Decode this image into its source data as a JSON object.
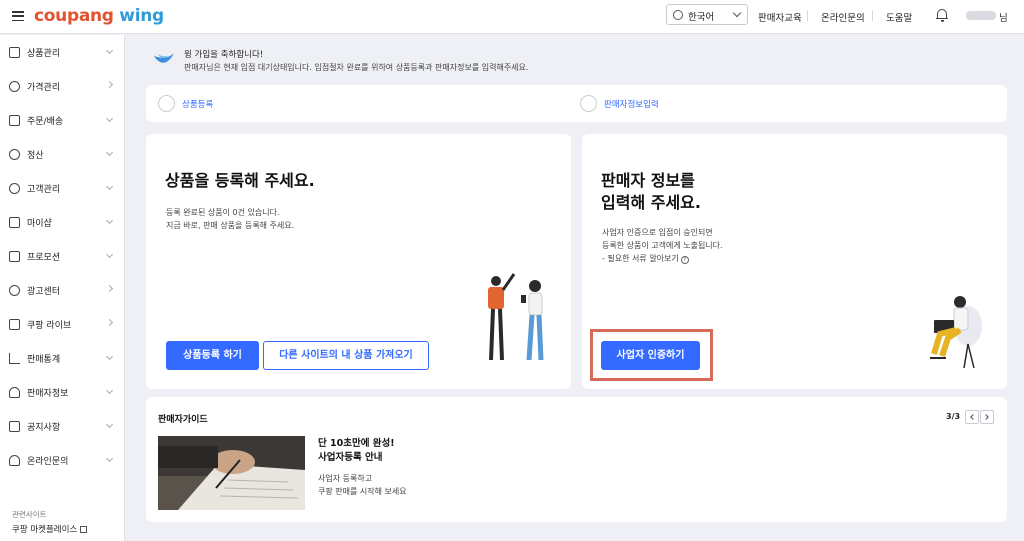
{
  "header": {
    "logo_part1": "coupang",
    "logo_part2": " wing",
    "language": "한국어",
    "links": [
      "판매자교육",
      "온라인문의",
      "도움말"
    ],
    "user_suffix": "님"
  },
  "sidebar": {
    "items": [
      {
        "label": "상품관리",
        "icon": "box-icon",
        "arrow": "down"
      },
      {
        "label": "가격관리",
        "icon": "medal-icon",
        "arrow": "right"
      },
      {
        "label": "주문/배송",
        "icon": "truck-icon",
        "arrow": "down"
      },
      {
        "label": "정산",
        "icon": "coin-icon",
        "arrow": "down"
      },
      {
        "label": "고객관리",
        "icon": "smile-icon",
        "arrow": "down"
      },
      {
        "label": "마이샵",
        "icon": "shop-icon",
        "arrow": "down"
      },
      {
        "label": "프로모션",
        "icon": "ticket-icon",
        "arrow": "down"
      },
      {
        "label": "광고센터",
        "icon": "chart-pie-icon",
        "arrow": "right"
      },
      {
        "label": "쿠팡 라이브",
        "icon": "video-icon",
        "arrow": "right"
      },
      {
        "label": "판매통계",
        "icon": "bar-chart-icon",
        "arrow": "down"
      },
      {
        "label": "판매자정보",
        "icon": "person-icon",
        "arrow": "down"
      },
      {
        "label": "공지사항",
        "icon": "megaphone-icon",
        "arrow": "down"
      },
      {
        "label": "온라인문의",
        "icon": "headset-icon",
        "arrow": "down"
      }
    ],
    "related_title": "관련사이트",
    "related_link": "쿠팡 마켓플레이스"
  },
  "welcome": {
    "title": "윙 가입을 축하합니다!",
    "desc": "판매자님은 현재 입점 대기상태입니다. 입점절차 완료를 위하여 상품등록과 판매자정보를 입력해주세요."
  },
  "steps": [
    "상품등록",
    "판매자정보입력"
  ],
  "product_card": {
    "title": "상품을 등록해 주세요.",
    "line1": "등록 완료된 상품이 0건 있습니다.",
    "line2": "지금 바로, 판매 상품을 등록해 주세요.",
    "btn_register": "상품등록 하기",
    "btn_import": "다른 사이트의 내 상품 가져오기"
  },
  "seller_card": {
    "title_line1": "판매자 정보를",
    "title_line2": "입력해 주세요.",
    "line1": "사업자 인증으로 입점이 승인되면",
    "line2": "등록한 상품이 고객에게 노출됩니다.",
    "line3": "- 필요한 서류 알아보기",
    "btn_verify": "사업자 인증하기"
  },
  "guide": {
    "title": "판매자가이드",
    "pager": "3/3",
    "head1": "단 10초만에 완성!",
    "head2": "사업자등록 안내",
    "desc1": "사업자 등록하고",
    "desc2": "쿠팡 판매를 시작해 보세요"
  },
  "colors": {
    "primary": "#346aff",
    "logo_red": "#e2522f",
    "logo_blue": "#2f9bd8",
    "highlight": "#d76b5a"
  }
}
